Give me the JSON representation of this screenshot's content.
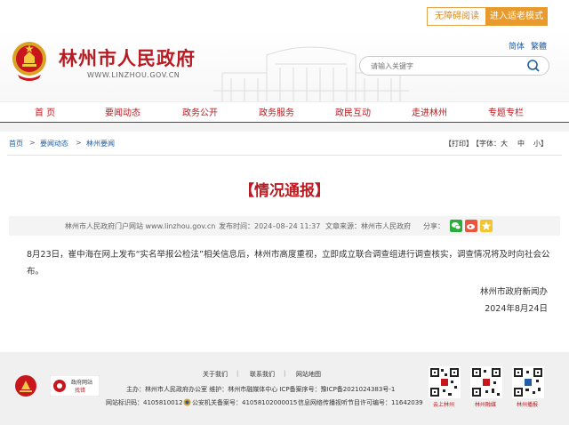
{
  "util": {
    "accessible": "无障碍阅读",
    "elder_mode": "进入适老模式"
  },
  "header": {
    "site_title": "林州市人民政府",
    "domain": "WWW.LINZHOU.GOV.CN",
    "lang_simple": "简体",
    "lang_trad": "繁體",
    "search_placeholder": "请输入关键字"
  },
  "nav": [
    "首  页",
    "要闻动态",
    "政务公开",
    "政务服务",
    "政民互动",
    "走进林州",
    "专题专栏"
  ],
  "breadcrumb": {
    "home": "首页",
    "sep": ">",
    "news": "要闻动态",
    "lz_news": "林州要闻"
  },
  "tools": {
    "print": "【打印】",
    "font_label": "【字体：",
    "large": "大",
    "medium": "中",
    "small": "小】"
  },
  "article": {
    "title": "【情况通报】",
    "source_site": "林州市人民政府门户网站 www.linzhou.gov.cn",
    "publish_time": "发布时间：2024–08–24 11:37",
    "article_source": "文章来源：林州市人民政府",
    "share_label": "分享：",
    "body": "8月23日，崔中海在网上发布“实名举报公检法”相关信息后，林州市高度重视，立即成立联合调查组进行调查核实，调查情况将及时向社会公布。",
    "sign_org": "林州市政府新闻办",
    "sign_date": "2024年8月24日"
  },
  "footer": {
    "links": [
      "关于我们",
      "联系我们",
      "网站地图"
    ],
    "sep": "|",
    "host_line": "主办：林州市人民政府办公室   维护：林州市融媒体中心   ICP备案序号：豫ICP备2021024383号-1",
    "site_id": "网站标识码：4105810012",
    "police_record": "公安机关备案号：41058102000015",
    "license": "信息网络传播视听节目许可编号：11642039",
    "gov_badge": "政府网站\n找错",
    "party_badge": "党政机关",
    "qr_labels": [
      "云上林州",
      "林州融媒",
      "林州播报"
    ]
  },
  "colors": {
    "brand_red": "#b81c22",
    "accent_orange": "#e99a2c",
    "link_blue": "#1f5ea8"
  }
}
